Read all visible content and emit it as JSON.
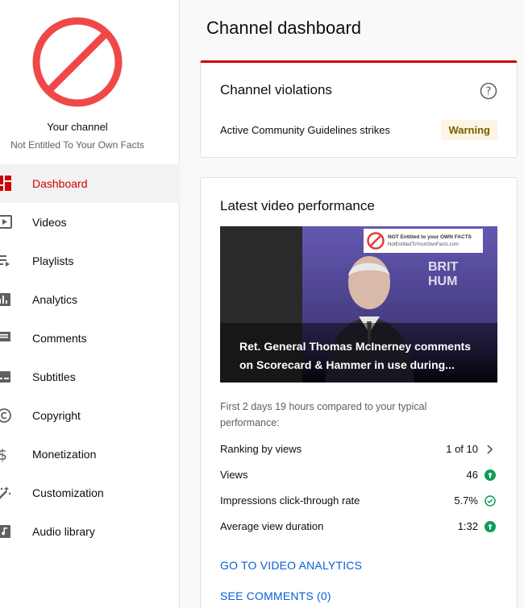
{
  "channel": {
    "title": "Your channel",
    "name": "Not Entitled To Your Own Facts"
  },
  "nav": {
    "items": [
      {
        "label": "Dashboard",
        "icon": "dashboard-icon",
        "active": true
      },
      {
        "label": "Videos",
        "icon": "videos-icon"
      },
      {
        "label": "Playlists",
        "icon": "playlists-icon"
      },
      {
        "label": "Analytics",
        "icon": "analytics-icon"
      },
      {
        "label": "Comments",
        "icon": "comments-icon"
      },
      {
        "label": "Subtitles",
        "icon": "subtitles-icon"
      },
      {
        "label": "Copyright",
        "icon": "copyright-icon"
      },
      {
        "label": "Monetization",
        "icon": "monetization-icon"
      },
      {
        "label": "Customization",
        "icon": "customization-icon"
      },
      {
        "label": "Audio library",
        "icon": "audio-library-icon"
      }
    ]
  },
  "page": {
    "title": "Channel dashboard"
  },
  "violations": {
    "title": "Channel violations",
    "row_label": "Active Community Guidelines strikes",
    "badge": "Warning"
  },
  "performance": {
    "title": "Latest video performance",
    "video_title": "Ret. General Thomas McInerney comments on Scorecard & Hammer in use during...",
    "watermark_line1": "NOT Entitled to your OWN FACTS",
    "watermark_line2": "NotEntitledToYourOwnFacts.com",
    "note": "First 2 days 19 hours compared to your typical performance:",
    "stats": [
      {
        "label": "Ranking by views",
        "value": "1 of 10",
        "icon": "chevron-right-icon"
      },
      {
        "label": "Views",
        "value": "46",
        "icon": "arrow-up-green-icon"
      },
      {
        "label": "Impressions click-through rate",
        "value": "5.7%",
        "icon": "check-circle-icon"
      },
      {
        "label": "Average view duration",
        "value": "1:32",
        "icon": "arrow-up-green-icon"
      }
    ],
    "link_analytics": "GO TO VIDEO ANALYTICS",
    "link_comments": "SEE COMMENTS (0)"
  },
  "colors": {
    "accent_red": "#cc0000",
    "link_blue": "#065fd4",
    "positive_green": "#0f9d58"
  }
}
